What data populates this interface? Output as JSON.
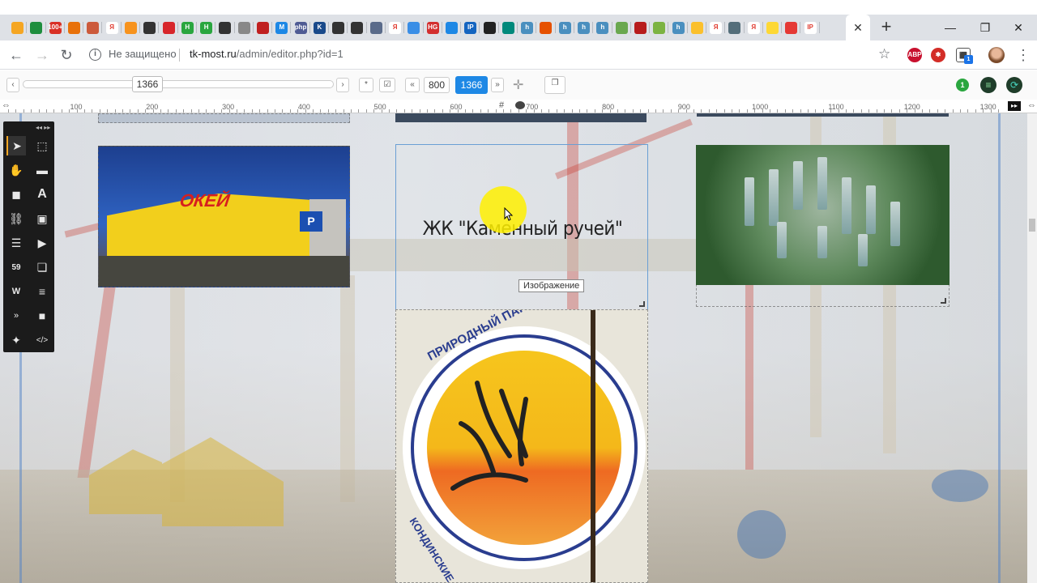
{
  "browser": {
    "active_tab_close": "✕",
    "new_tab": "+",
    "tabs_favicons": [
      {
        "icon": "tk-most-favicon",
        "color": "#f5a623",
        "text": ""
      },
      {
        "icon": "google-drive-icon",
        "color": "#1e8e3e",
        "text": ""
      },
      {
        "icon": "gmail-icon",
        "color": "#d93025",
        "text": "100+"
      },
      {
        "icon": "bars-icon",
        "color": "#e8710a",
        "text": ""
      },
      {
        "icon": "shield-icon",
        "color": "#cc5a3b",
        "text": ""
      },
      {
        "icon": "yandex-icon",
        "color": "#ffffff",
        "text": "Я"
      },
      {
        "icon": "odnoklassniki-icon",
        "color": "#f7931e",
        "text": ""
      },
      {
        "icon": "panda-icon",
        "color": "#333333",
        "text": ""
      },
      {
        "icon": "opera-icon",
        "color": "#d7262b",
        "text": ""
      },
      {
        "icon": "green-h-icon",
        "color": "#2aa63f",
        "text": "Н"
      },
      {
        "icon": "green-h-icon",
        "color": "#2aa63f",
        "text": "Н"
      },
      {
        "icon": "panda-icon",
        "color": "#333333",
        "text": ""
      },
      {
        "icon": "cart-icon",
        "color": "#888888",
        "text": ""
      },
      {
        "icon": "red-square-icon",
        "color": "#c02020",
        "text": ""
      },
      {
        "icon": "m-icon",
        "color": "#1e88e5",
        "text": "M"
      },
      {
        "icon": "php-icon",
        "color": "#4f5b93",
        "text": "php"
      },
      {
        "icon": "k-icon",
        "color": "#1a4a8a",
        "text": "K"
      },
      {
        "icon": "panda-icon",
        "color": "#333333",
        "text": ""
      },
      {
        "icon": "panda-icon",
        "color": "#333333",
        "text": ""
      },
      {
        "icon": "globe-icon",
        "color": "#5a6b8a",
        "text": ""
      },
      {
        "icon": "yandex-icon",
        "color": "#ffffff",
        "text": "Я"
      },
      {
        "icon": "grid-icon",
        "color": "#3a8ee6",
        "text": ""
      },
      {
        "icon": "hg-icon",
        "color": "#d32f2f",
        "text": "HG"
      },
      {
        "icon": "printer-icon",
        "color": "#1e88e5",
        "text": ""
      },
      {
        "icon": "ip-icon",
        "color": "#1565c0",
        "text": "IP"
      },
      {
        "icon": "glasses-icon",
        "color": "#222222",
        "text": ""
      },
      {
        "icon": "teal-circle-icon",
        "color": "#00897b",
        "text": ""
      },
      {
        "icon": "h-icon",
        "color": "#4a8fbf",
        "text": "h"
      },
      {
        "icon": "orange-circle-icon",
        "color": "#e65100",
        "text": ""
      },
      {
        "icon": "h-icon",
        "color": "#4a8fbf",
        "text": "h"
      },
      {
        "icon": "h-icon",
        "color": "#4a8fbf",
        "text": "h"
      },
      {
        "icon": "h-icon",
        "color": "#4a8fbf",
        "text": "h"
      },
      {
        "icon": "green-leaf-icon",
        "color": "#6aa84f",
        "text": ""
      },
      {
        "icon": "m-red-icon",
        "color": "#b71c1c",
        "text": ""
      },
      {
        "icon": "balloon-icon",
        "color": "#7cb342",
        "text": ""
      },
      {
        "icon": "h-icon",
        "color": "#4a8fbf",
        "text": "h"
      },
      {
        "icon": "yellow-icon",
        "color": "#fbc02d",
        "text": ""
      },
      {
        "icon": "yandex-icon",
        "color": "#ffffff",
        "text": "Я"
      },
      {
        "icon": "hat-icon",
        "color": "#546e7a",
        "text": ""
      },
      {
        "icon": "yandex-icon",
        "color": "#ffffff",
        "text": "Я"
      },
      {
        "icon": "arrow-yellow-icon",
        "color": "#fdd835",
        "text": ""
      },
      {
        "icon": "red-dot-icon",
        "color": "#e53935",
        "text": ""
      },
      {
        "icon": "ip-icon",
        "color": "#ffffff",
        "text": "IP"
      }
    ],
    "window_controls": {
      "minimize": "—",
      "restore": "❐",
      "close": "✕"
    },
    "nav": {
      "back": "←",
      "forward": "→",
      "reload": "↻"
    },
    "security_label": "Не защищено",
    "url_host": "tk-most.ru",
    "url_path": "/admin/editor.php?id=1",
    "bookmark": "☆",
    "extensions": [
      {
        "name": "adblock-plus-icon",
        "label": "ABP",
        "color": "#c8102e"
      },
      {
        "name": "lastpass-icon",
        "label": "",
        "color": "#d32d27"
      },
      {
        "name": "extension-badge-icon",
        "label": "1",
        "color": "#444444"
      }
    ],
    "menu": "⋮"
  },
  "editor": {
    "slider_value": "1366",
    "width_800": "800",
    "width_1366": "1366",
    "badge_count": "1",
    "ruler_ticks": [
      "100",
      "200",
      "300",
      "400",
      "500",
      "600",
      "700",
      "800",
      "900",
      "1000",
      "1100",
      "1200",
      "1300"
    ],
    "ruler_hash": "#"
  },
  "canvas": {
    "heading": "ЖК \"Каменный ручей\"",
    "tooltip": "Изображение",
    "okey_logo": "ОКЕЙ",
    "okey_parking": "P",
    "park_text_top": "ПРИРОДНЫЙ ПАРК",
    "park_text_side": "КОНДИНСКИЕ ОЗ"
  },
  "colors": {
    "accent": "#1e88e5",
    "toolbox": "#1b1b1b",
    "active_tool": "#f5a623",
    "selection": "#6a9fd4"
  }
}
